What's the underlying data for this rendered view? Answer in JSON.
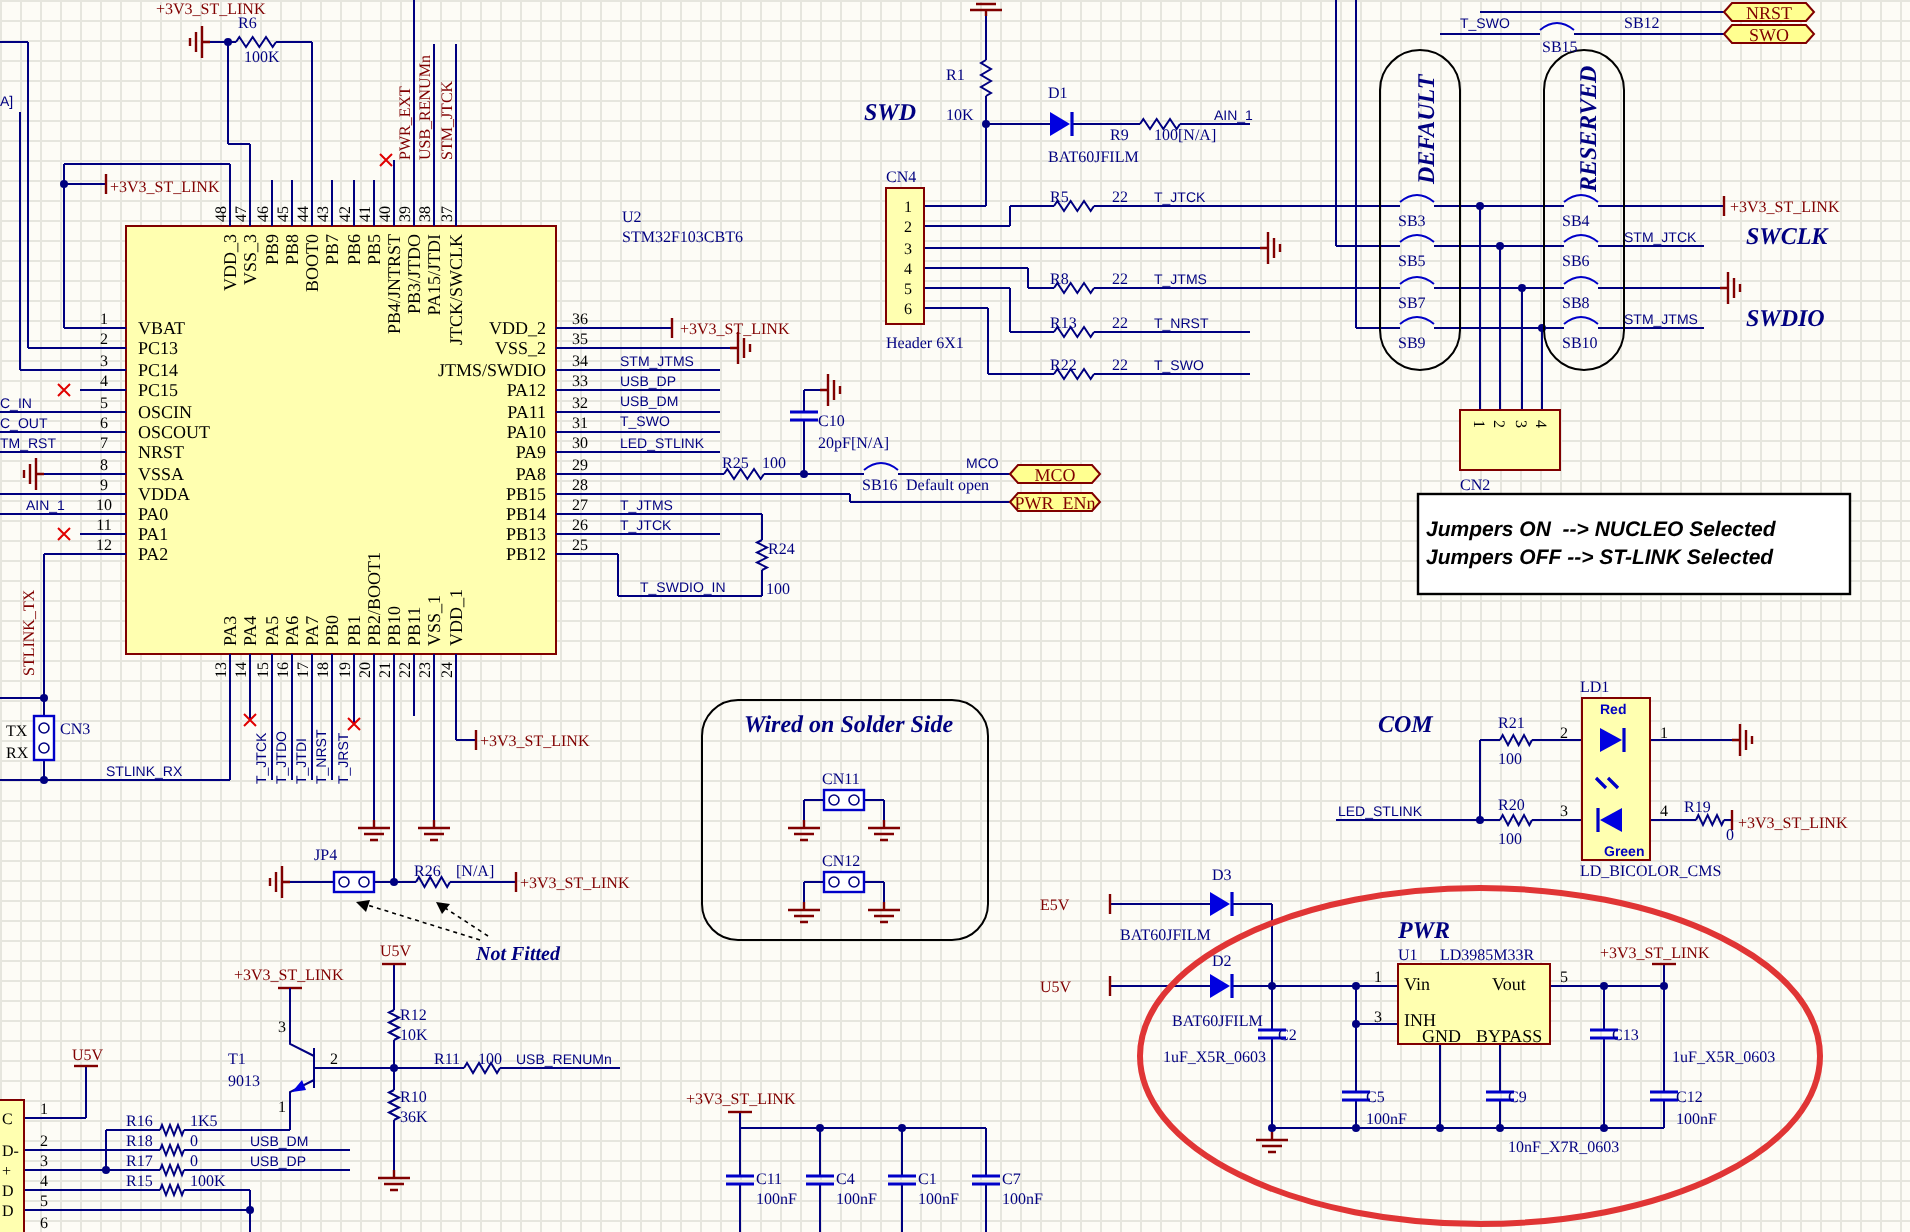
{
  "schematic": {
    "mcu": {
      "top_pins": [
        {
          "num": "48",
          "name": "VDD_3"
        },
        {
          "num": "47",
          "name": "VSS_3"
        },
        {
          "num": "46",
          "name": "PB9"
        },
        {
          "num": "45",
          "name": "PB8"
        },
        {
          "num": "44",
          "name": "BOOT0"
        },
        {
          "num": "43",
          "name": "PB7"
        },
        {
          "num": "42",
          "name": "PB6"
        },
        {
          "num": "41",
          "name": "PB5"
        },
        {
          "num": "40",
          "name": "PB4/JNTRST"
        },
        {
          "num": "39",
          "name": "PB3/JTDO"
        },
        {
          "num": "38",
          "name": "PA15/JTDI"
        },
        {
          "num": "37",
          "name": "JTCK/SWCLK"
        }
      ],
      "left_pins": [
        {
          "num": "1",
          "name": "VBAT"
        },
        {
          "num": "2",
          "name": "PC13"
        },
        {
          "num": "3",
          "name": "PC14"
        },
        {
          "num": "4",
          "name": "PC15"
        },
        {
          "num": "5",
          "name": "OSCIN"
        },
        {
          "num": "6",
          "name": "OSCOUT"
        },
        {
          "num": "7",
          "name": "NRST"
        },
        {
          "num": "8",
          "name": "VSSA"
        },
        {
          "num": "9",
          "name": "VDDA"
        },
        {
          "num": "10",
          "name": "PA0"
        },
        {
          "num": "11",
          "name": "PA1"
        },
        {
          "num": "12",
          "name": "PA2"
        }
      ],
      "right_pins": [
        {
          "num": "36",
          "name": "VDD_2"
        },
        {
          "num": "35",
          "name": "VSS_2"
        },
        {
          "num": "34",
          "name": "JTMS/SWDIO"
        },
        {
          "num": "33",
          "name": "PA12"
        },
        {
          "num": "32",
          "name": "PA11"
        },
        {
          "num": "31",
          "name": "PA10"
        },
        {
          "num": "30",
          "name": "PA9"
        },
        {
          "num": "29",
          "name": "PA8"
        },
        {
          "num": "28",
          "name": "PB15"
        },
        {
          "num": "27",
          "name": "PB14"
        },
        {
          "num": "26",
          "name": "PB13"
        },
        {
          "num": "25",
          "name": "PB12"
        }
      ],
      "bottom_pins": [
        {
          "num": "13",
          "name": "PA3"
        },
        {
          "num": "14",
          "name": "PA4"
        },
        {
          "num": "15",
          "name": "PA5"
        },
        {
          "num": "16",
          "name": "PA6"
        },
        {
          "num": "17",
          "name": "PA7"
        },
        {
          "num": "18",
          "name": "PB0"
        },
        {
          "num": "19",
          "name": "PB1"
        },
        {
          "num": "20",
          "name": "PB2/BOOT1"
        },
        {
          "num": "21",
          "name": "PB10"
        },
        {
          "num": "22",
          "name": "PB11"
        },
        {
          "num": "23",
          "name": "VSS_1"
        },
        {
          "num": "24",
          "name": "VDD_1"
        }
      ]
    },
    "ports": [
      {
        "text": "MCO"
      },
      {
        "text": "PWR_ENn"
      },
      {
        "text": "NRST"
      },
      {
        "text": "SWO"
      }
    ],
    "labels": [
      {
        "text": "+3V3_ST_LINK",
        "kind": "power"
      },
      {
        "text": "R6",
        "kind": "ref"
      },
      {
        "text": "100K",
        "kind": "value"
      },
      {
        "text": "PWR_EXT",
        "kind": "power"
      },
      {
        "text": "USB_RENUMn",
        "kind": "power"
      },
      {
        "text": "STM_JTCK",
        "kind": "power"
      },
      {
        "text": "+3V3_ST_LINK",
        "kind": "power"
      },
      {
        "text": "A]",
        "kind": "net"
      },
      {
        "text": "C_IN",
        "kind": "net"
      },
      {
        "text": "C_OUT",
        "kind": "net"
      },
      {
        "text": "TM_RST",
        "kind": "net"
      },
      {
        "text": "AIN_1",
        "kind": "net"
      },
      {
        "text": "STLINK_TX",
        "kind": "power"
      },
      {
        "text": "U2",
        "kind": "ref"
      },
      {
        "text": "STM32F103CBT6",
        "kind": "ref"
      },
      {
        "text": "+3V3_ST_LINK",
        "kind": "power"
      },
      {
        "text": "STM_JTMS",
        "kind": "net"
      },
      {
        "text": "USB_DP",
        "kind": "net"
      },
      {
        "text": "USB_DM",
        "kind": "net"
      },
      {
        "text": "T_SWO",
        "kind": "net"
      },
      {
        "text": "LED_STLINK",
        "kind": "net"
      },
      {
        "text": "R25",
        "kind": "ref"
      },
      {
        "text": "100",
        "kind": "value"
      },
      {
        "text": "T_JTMS",
        "kind": "net"
      },
      {
        "text": "T_JTCK",
        "kind": "net"
      },
      {
        "text": "R24",
        "kind": "ref"
      },
      {
        "text": "T_SWDIO_IN",
        "kind": "net"
      },
      {
        "text": "100",
        "kind": "value"
      },
      {
        "text": "C10",
        "kind": "ref"
      },
      {
        "text": "20pF[N/A]",
        "kind": "value"
      },
      {
        "text": "SB16",
        "kind": "ref"
      },
      {
        "text": "Default open",
        "kind": "value"
      },
      {
        "text": "MCO",
        "kind": "net"
      },
      {
        "text": "SWD",
        "kind": "title"
      },
      {
        "text": "R1",
        "kind": "ref"
      },
      {
        "text": "10K",
        "kind": "value"
      },
      {
        "text": "D1",
        "kind": "ref"
      },
      {
        "text": "BAT60JFILM",
        "kind": "value"
      },
      {
        "text": "R9",
        "kind": "ref"
      },
      {
        "text": "100[N/A]",
        "kind": "value"
      },
      {
        "text": "AIN_1",
        "kind": "net"
      },
      {
        "text": "CN4",
        "kind": "ref"
      },
      {
        "text": "Header 6X1",
        "kind": "ref"
      },
      {
        "text": "R5",
        "kind": "ref"
      },
      {
        "text": "22",
        "kind": "value"
      },
      {
        "text": "T_JTCK",
        "kind": "net"
      },
      {
        "text": "R8",
        "kind": "ref"
      },
      {
        "text": "22",
        "kind": "value"
      },
      {
        "text": "T_JTMS",
        "kind": "net"
      },
      {
        "text": "R13",
        "kind": "ref"
      },
      {
        "text": "22",
        "kind": "value"
      },
      {
        "text": "T_NRST",
        "kind": "net"
      },
      {
        "text": "R22",
        "kind": "ref"
      },
      {
        "text": "22",
        "kind": "value"
      },
      {
        "text": "T_SWO",
        "kind": "net"
      },
      {
        "text": "T_SWO",
        "kind": "net"
      },
      {
        "text": "SB15",
        "kind": "ref"
      },
      {
        "text": "SB12",
        "kind": "ref"
      },
      {
        "text": "DEFAULT",
        "kind": "title"
      },
      {
        "text": "RESERVED",
        "kind": "title"
      },
      {
        "text": "SB3",
        "kind": "ref"
      },
      {
        "text": "SB5",
        "kind": "ref"
      },
      {
        "text": "SB7",
        "kind": "ref"
      },
      {
        "text": "SB9",
        "kind": "ref"
      },
      {
        "text": "SB4",
        "kind": "ref"
      },
      {
        "text": "SB6",
        "kind": "ref"
      },
      {
        "text": "SB8",
        "kind": "ref"
      },
      {
        "text": "SB10",
        "kind": "ref"
      },
      {
        "text": "+3V3_ST_LINK",
        "kind": "power"
      },
      {
        "text": "STM_JTCK",
        "kind": "net"
      },
      {
        "text": "SWCLK",
        "kind": "title"
      },
      {
        "text": "STM_JTMS",
        "kind": "net"
      },
      {
        "text": "SWDIO",
        "kind": "title"
      },
      {
        "text": "CN2",
        "kind": "ref"
      },
      {
        "text": "Jumpers ON  --> NUCLEO Selected",
        "kind": "note"
      },
      {
        "text": "Jumpers OFF --> ST-LINK Selected",
        "kind": "note"
      },
      {
        "text": "STLINK_RX",
        "kind": "net"
      },
      {
        "text": "TX",
        "kind": "pin"
      },
      {
        "text": "RX",
        "kind": "pin"
      },
      {
        "text": "CN3",
        "kind": "ref"
      },
      {
        "text": "T_JTCK",
        "kind": "net"
      },
      {
        "text": "T_JTDO",
        "kind": "net"
      },
      {
        "text": "T_JTDI",
        "kind": "net"
      },
      {
        "text": "T_NRST",
        "kind": "net"
      },
      {
        "text": "T_JRST",
        "kind": "net"
      },
      {
        "text": "+3V3_ST_LINK",
        "kind": "power"
      },
      {
        "text": "JP4",
        "kind": "ref"
      },
      {
        "text": "R26",
        "kind": "ref"
      },
      {
        "text": "[N/A]",
        "kind": "value"
      },
      {
        "text": "+3V3_ST_LINK",
        "kind": "power"
      },
      {
        "text": "U5V",
        "kind": "power"
      },
      {
        "text": "Not Fitted",
        "kind": "annot"
      },
      {
        "text": "+3V3_ST_LINK",
        "kind": "power"
      },
      {
        "text": "R12",
        "kind": "ref"
      },
      {
        "text": "10K",
        "kind": "value"
      },
      {
        "text": "T1",
        "kind": "ref"
      },
      {
        "text": "9013",
        "kind": "value"
      },
      {
        "text": "3",
        "kind": "pin"
      },
      {
        "text": "2",
        "kind": "pin"
      },
      {
        "text": "1",
        "kind": "pin"
      },
      {
        "text": "R11",
        "kind": "ref"
      },
      {
        "text": "100",
        "kind": "value"
      },
      {
        "text": "USB_RENUMn",
        "kind": "net"
      },
      {
        "text": "R10",
        "kind": "ref"
      },
      {
        "text": "36K",
        "kind": "value"
      },
      {
        "text": "U5V",
        "kind": "power"
      },
      {
        "text": "R16",
        "kind": "ref"
      },
      {
        "text": "1K5",
        "kind": "value"
      },
      {
        "text": "R18",
        "kind": "ref"
      },
      {
        "text": "0",
        "kind": "value"
      },
      {
        "text": "USB_DM",
        "kind": "net"
      },
      {
        "text": "R17",
        "kind": "ref"
      },
      {
        "text": "0",
        "kind": "value"
      },
      {
        "text": "USB_DP",
        "kind": "net"
      },
      {
        "text": "R15",
        "kind": "ref"
      },
      {
        "text": "100K",
        "kind": "value"
      },
      {
        "text": "1",
        "kind": "pin"
      },
      {
        "text": "2",
        "kind": "pin"
      },
      {
        "text": "3",
        "kind": "pin"
      },
      {
        "text": "4",
        "kind": "pin"
      },
      {
        "text": "5",
        "kind": "pin"
      },
      {
        "text": "6",
        "kind": "pin"
      },
      {
        "text": "C",
        "kind": "pin"
      },
      {
        "text": "D-",
        "kind": "pin"
      },
      {
        "text": "+",
        "kind": "pin"
      },
      {
        "text": "D",
        "kind": "pin"
      },
      {
        "text": "D",
        "kind": "pin"
      },
      {
        "text": "Wired on Solder Side",
        "kind": "title"
      },
      {
        "text": "CN11",
        "kind": "ref"
      },
      {
        "text": "CN12",
        "kind": "ref"
      },
      {
        "text": "+3V3_ST_LINK",
        "kind": "power"
      },
      {
        "text": "C11",
        "kind": "ref"
      },
      {
        "text": "100nF",
        "kind": "value"
      },
      {
        "text": "C4",
        "kind": "ref"
      },
      {
        "text": "100nF",
        "kind": "value"
      },
      {
        "text": "C1",
        "kind": "ref"
      },
      {
        "text": "100nF",
        "kind": "value"
      },
      {
        "text": "C7",
        "kind": "ref"
      },
      {
        "text": "100nF",
        "kind": "value"
      },
      {
        "text": "E5V",
        "kind": "power"
      },
      {
        "text": "U5V",
        "kind": "power"
      },
      {
        "text": "D3",
        "kind": "ref"
      },
      {
        "text": "BAT60JFILM",
        "kind": "value"
      },
      {
        "text": "D2",
        "kind": "ref"
      },
      {
        "text": "BAT60JFILM",
        "kind": "value"
      },
      {
        "text": "PWR",
        "kind": "title"
      },
      {
        "text": "U1",
        "kind": "ref"
      },
      {
        "text": "LD3985M33R",
        "kind": "ref"
      },
      {
        "text": "Vin",
        "kind": "pinname"
      },
      {
        "text": "Vout",
        "kind": "pinname"
      },
      {
        "text": "INH",
        "kind": "pinname"
      },
      {
        "text": "GND",
        "kind": "pinname"
      },
      {
        "text": "BYPASS",
        "kind": "pinname"
      },
      {
        "text": "1",
        "kind": "pin"
      },
      {
        "text": "3",
        "kind": "pin"
      },
      {
        "text": "5",
        "kind": "pin"
      },
      {
        "text": "+3V3_ST_LINK",
        "kind": "power"
      },
      {
        "text": "C2",
        "kind": "ref"
      },
      {
        "text": "1uF_X5R_0603",
        "kind": "value"
      },
      {
        "text": "C13",
        "kind": "ref"
      },
      {
        "text": "1uF_X5R_0603",
        "kind": "value"
      },
      {
        "text": "C5",
        "kind": "ref"
      },
      {
        "text": "100nF",
        "kind": "value"
      },
      {
        "text": "C9",
        "kind": "ref"
      },
      {
        "text": "10nF_X7R_0603",
        "kind": "value"
      },
      {
        "text": "C12",
        "kind": "ref"
      },
      {
        "text": "100nF",
        "kind": "value"
      },
      {
        "text": "COM",
        "kind": "title"
      },
      {
        "text": "LD1",
        "kind": "ref"
      },
      {
        "text": "Red",
        "kind": "led"
      },
      {
        "text": "Green",
        "kind": "led"
      },
      {
        "text": "R21",
        "kind": "ref"
      },
      {
        "text": "100",
        "kind": "value"
      },
      {
        "text": "2",
        "kind": "pin"
      },
      {
        "text": "1",
        "kind": "pin"
      },
      {
        "text": "LED_STLINK",
        "kind": "net"
      },
      {
        "text": "R20",
        "kind": "ref"
      },
      {
        "text": "100",
        "kind": "value"
      },
      {
        "text": "3",
        "kind": "pin"
      },
      {
        "text": "4",
        "kind": "pin"
      },
      {
        "text": "R19",
        "kind": "ref"
      },
      {
        "text": "0",
        "kind": "value"
      },
      {
        "text": "+3V3_ST_LINK",
        "kind": "power"
      },
      {
        "text": "LD_BICOLOR_CMS",
        "kind": "ref"
      },
      {
        "text": "1",
        "kind": "pin"
      },
      {
        "text": "2",
        "kind": "pin"
      },
      {
        "text": "3",
        "kind": "pin"
      },
      {
        "text": "4",
        "kind": "pin"
      },
      {
        "text": "5",
        "kind": "pin"
      },
      {
        "text": "6",
        "kind": "pin"
      },
      {
        "text": "1",
        "kind": "pin"
      },
      {
        "text": "2",
        "kind": "pin"
      },
      {
        "text": "3",
        "kind": "pin"
      },
      {
        "text": "4",
        "kind": "pin"
      }
    ]
  }
}
